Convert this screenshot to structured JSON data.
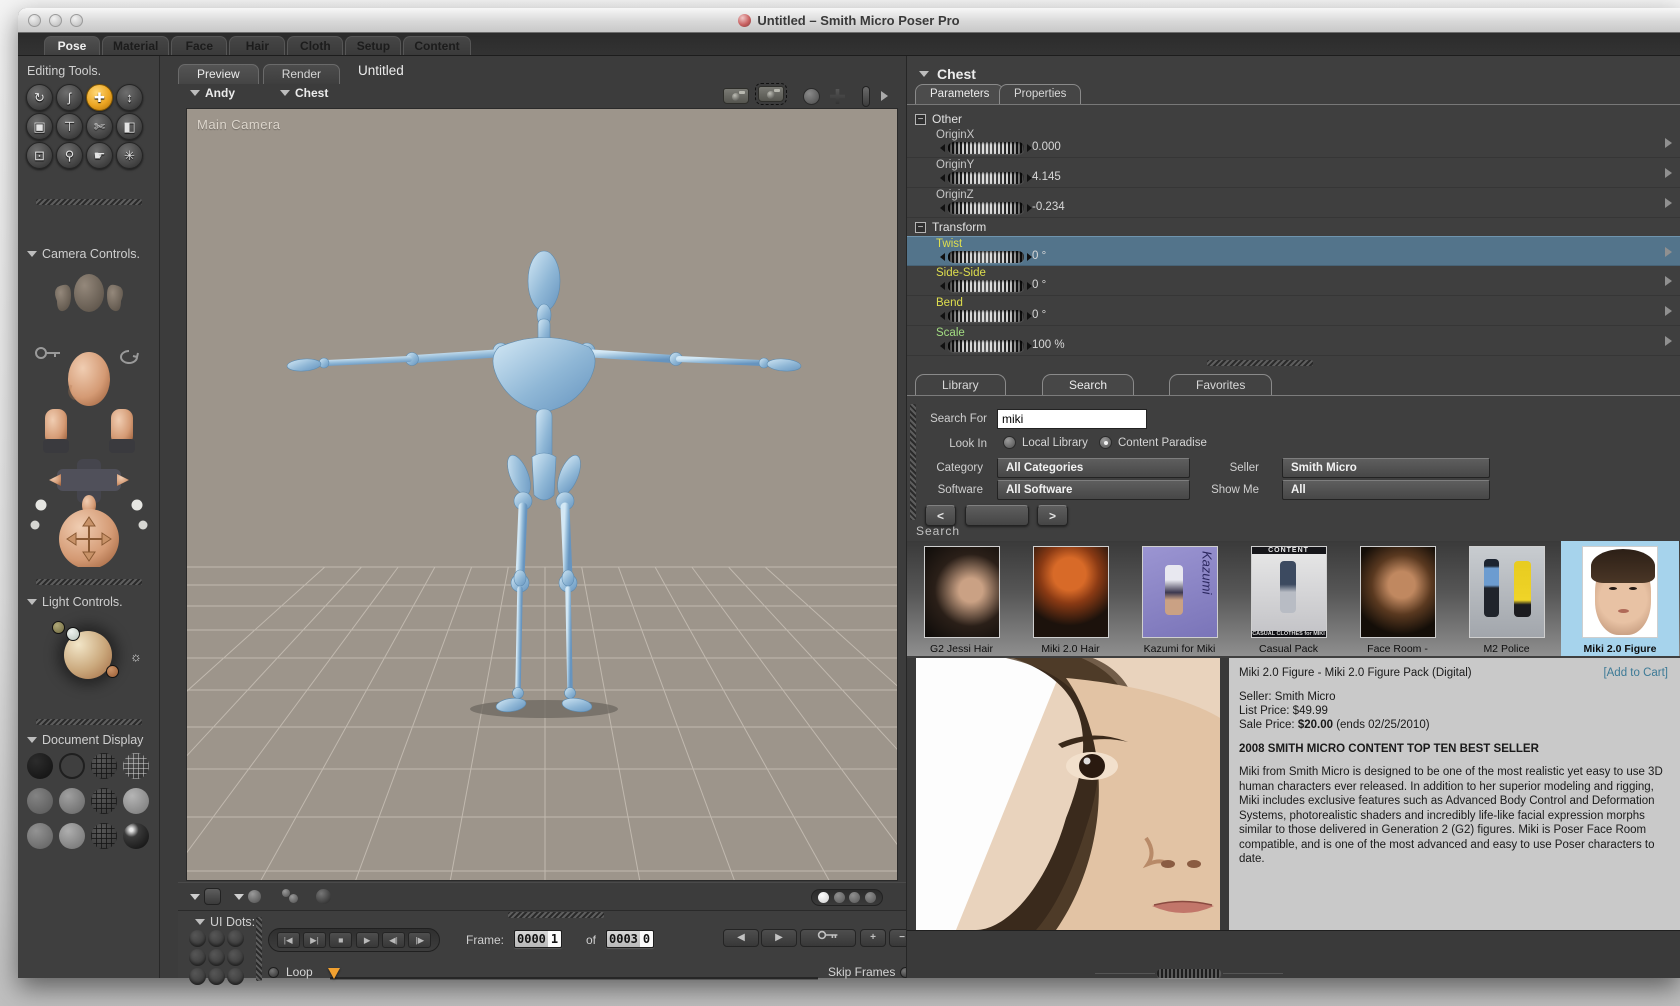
{
  "window": {
    "title": "Untitled – Smith Micro Poser Pro"
  },
  "app_tabs": {
    "pose": "Pose",
    "material": "Material",
    "face": "Face",
    "hair": "Hair",
    "cloth": "Cloth",
    "setup": "Setup",
    "content": "Content",
    "active": "Pose"
  },
  "sidebar": {
    "editing_tools_title": "Editing Tools.",
    "camera_controls_title": "Camera Controls.",
    "light_controls_title": "Light Controls.",
    "document_display_title": "Document Display"
  },
  "glyphs": {
    "rotate": "↻",
    "twist": "ʃ",
    "translate": "✚",
    "translate_z": "↕",
    "scale": "▣",
    "taper": "⊤",
    "grouping": "✄",
    "color": "◧",
    "chain_break": "⊡",
    "magnifier": "⚲",
    "finger": "☛",
    "direct_manip": "✳",
    "sun": "☼",
    "minus_box": "−",
    "first_frame": "|◀",
    "last_frame": "▶|",
    "stop": "■",
    "play": "▶",
    "step_back": "◀|",
    "step_fwd": "|▶",
    "back": "◀",
    "fwd": "▶",
    "plus": "+",
    "minus": "−",
    "prev": "<",
    "next": ">"
  },
  "document": {
    "preview_tab": "Preview",
    "render_tab": "Render",
    "doc_title": "Untitled",
    "figure_selector": "Andy",
    "actor_selector": "Chest",
    "camera_label": "Main Camera"
  },
  "params": {
    "header": "Chest",
    "tab_parameters": "Parameters",
    "tab_properties": "Properties",
    "group_other": "Other",
    "group_transform": "Transform",
    "rows": [
      {
        "label": "OriginX",
        "value": "0.000"
      },
      {
        "label": "OriginY",
        "value": "4.145"
      },
      {
        "label": "OriginZ",
        "value": "-0.234"
      },
      {
        "label": "Twist",
        "value": "0 °"
      },
      {
        "label": "Side-Side",
        "value": "0 °"
      },
      {
        "label": "Bend",
        "value": "0 °"
      },
      {
        "label": "Scale",
        "value": "100 %"
      }
    ],
    "selected_row": "Twist",
    "selected_row_color": "#53748b"
  },
  "library": {
    "tab_library": "Library",
    "tab_search": "Search",
    "tab_favorites": "Favorites",
    "active_tab": "Search",
    "search_for_label": "Search For",
    "search_value": "miki",
    "look_in_label": "Look In",
    "radio_local": "Local Library",
    "radio_paradise": "Content Paradise",
    "look_in_selected": "Content Paradise",
    "category_label": "Category",
    "category_value": "All Categories",
    "seller_label": "Seller",
    "seller_value": "Smith Micro",
    "software_label": "Software",
    "software_value": "All Software",
    "show_me_label": "Show Me",
    "show_me_value": "All",
    "results_label": "Search"
  },
  "results": {
    "items": [
      {
        "label": "G2 Jessi Hair"
      },
      {
        "label": "Miki 2.0 Hair"
      },
      {
        "label": "Kazumi for Miki",
        "overlay": "Kazumi"
      },
      {
        "label": "Casual Pack",
        "overlay_top": "CONTENT",
        "overlay_bottom": "CASUAL CLOTHES for MIKI"
      },
      {
        "label": "Face Room -"
      },
      {
        "label": "M2 Police"
      },
      {
        "label": "Miki 2.0 Figure",
        "selected": true
      }
    ]
  },
  "product": {
    "title": "Miki 2.0 Figure - Miki 2.0 Figure Pack (Digital)",
    "add_to_cart": "[Add to Cart]",
    "seller": "Seller: Smith Micro",
    "list_price": "List Price: $49.99",
    "sale_price_label": "Sale Price:",
    "sale_price": "$20.00",
    "sale_price_note": "(ends 02/25/2010)",
    "banner": "2008 SMITH MICRO CONTENT TOP TEN BEST SELLER",
    "description": "Miki from Smith Micro is designed to be one of the most realistic yet easy to use 3D human characters ever released. In addition to her superior modeling and rigging, Miki includes exclusive features such as Advanced Body Control and Deformation Systems, photorealistic shaders and incredibly life-like facial expression morphs similar to those delivered in Generation 2 (G2) figures. Miki is Poser Face Room compatible, and is one of the most advanced and easy to use Poser characters to date."
  },
  "timeline": {
    "ui_dots_label": "UI Dots:",
    "frame_label": "Frame:",
    "frame_current_main": "0000",
    "frame_current_last": "1",
    "frame_of": "of",
    "frame_total_main": "0003",
    "frame_total_last": "0",
    "loop_label": "Loop",
    "skip_frames_label": "Skip Frames"
  },
  "colors": {
    "accent_tool": "#eca623",
    "selected_row": "#53748b",
    "viewport": "#9d958b",
    "figure_blue": "#8fb7d6",
    "selection_blue": "#a6d3ec",
    "marker_orange": "#f0a030"
  }
}
